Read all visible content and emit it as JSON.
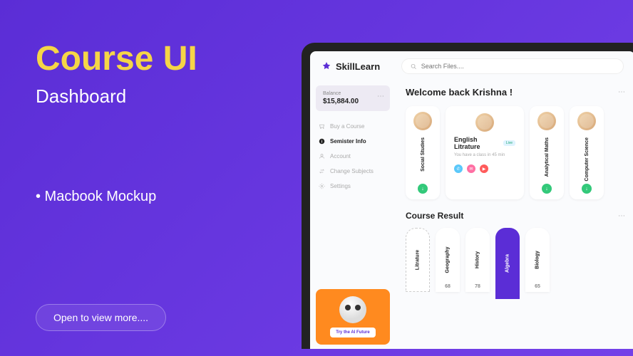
{
  "slide": {
    "title": "Course UI",
    "subtitle": "Dashboard",
    "bullet": "• Macbook Mockup",
    "cta": "Open to view more...."
  },
  "app": {
    "brand": "SkillLearn",
    "search_placeholder": "Search Files....",
    "balance": {
      "label": "Balance",
      "value": "$15,884.00"
    },
    "nav": [
      {
        "label": "Buy a Course"
      },
      {
        "label": "Semister Info"
      },
      {
        "label": "Account"
      },
      {
        "label": "Change Subjects"
      },
      {
        "label": "Settings"
      }
    ],
    "promo_btn": "Try the AI Future",
    "welcome": "Welcome back Krishna !",
    "courses": [
      {
        "title": "Social Studies",
        "layout": "narrow"
      },
      {
        "title": "English Litrature",
        "badge": "Live",
        "sub": "You have a class in 45 min",
        "layout": "wide"
      },
      {
        "title": "Analytical Maths",
        "layout": "narrow"
      },
      {
        "title": "Computer Science",
        "layout": "narrow"
      }
    ],
    "results_title": "Course Result",
    "chart_data": {
      "type": "bar",
      "categories": [
        "Litrature",
        "Geography",
        "History",
        "Algebra",
        "Biology"
      ],
      "values": [
        null,
        68,
        78,
        null,
        65
      ],
      "highlighted_index": 3,
      "dashed_index": 0,
      "ylabel": "",
      "title": "Course Result"
    }
  }
}
